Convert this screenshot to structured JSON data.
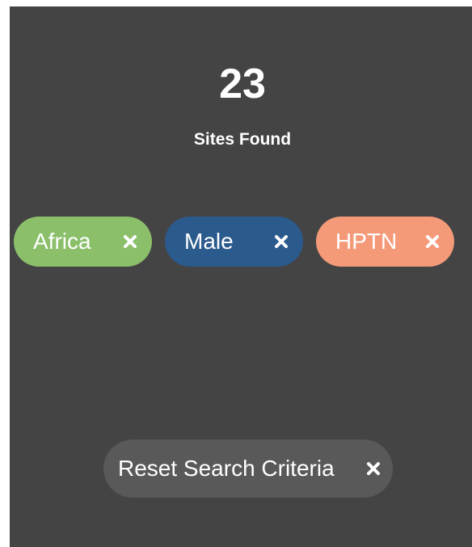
{
  "results": {
    "count": "23",
    "label": "Sites Found"
  },
  "filters": [
    {
      "label": "Africa",
      "color": "#8bbf6a",
      "close_icon": "close-icon"
    },
    {
      "label": "Male",
      "color": "#2b5a8d",
      "close_icon": "close-icon"
    },
    {
      "label": "HPTN",
      "color": "#f59a79",
      "close_icon": "close-icon"
    }
  ],
  "reset": {
    "label": "Reset Search Criteria",
    "icon": "close-icon"
  },
  "colors": {
    "panel_background": "#444444",
    "reset_background": "#595959",
    "text": "#ffffff"
  }
}
